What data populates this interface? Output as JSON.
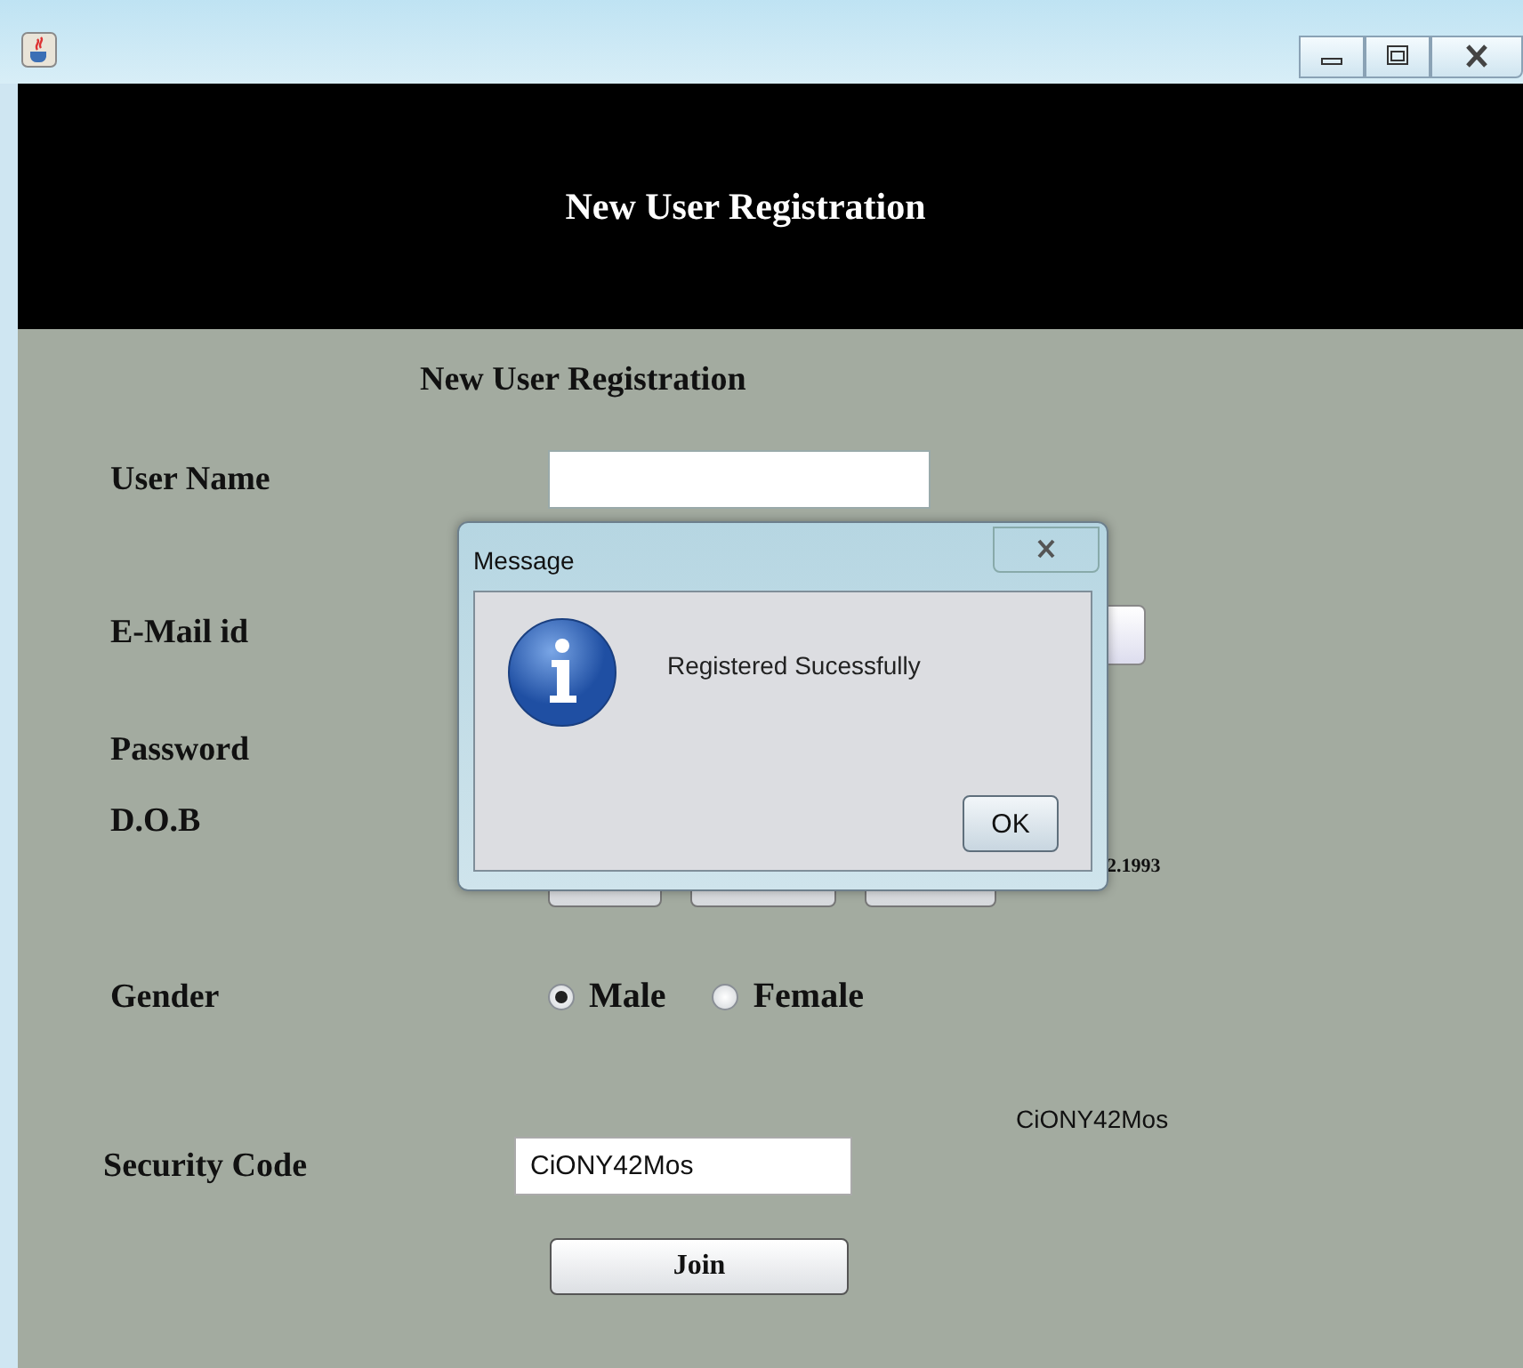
{
  "header": {
    "title": "New User Registration"
  },
  "form": {
    "subtitle": "New User Registration",
    "user_name": {
      "label": "User Name"
    },
    "email": {
      "label": "E-Mail id"
    },
    "password": {
      "label": "Password"
    },
    "dob": {
      "label": "D.O.B",
      "date_text": "2.1993"
    },
    "gender": {
      "label": "Gender",
      "options": [
        {
          "label": "Male",
          "selected": true
        },
        {
          "label": "Female",
          "selected": false
        }
      ]
    },
    "security_code": {
      "label": "Security Code",
      "value": "CiONY42Mos",
      "code_text": "CiONY42Mos"
    },
    "join_button": "Join"
  },
  "dialog": {
    "title": "Message",
    "message": "Registered Sucessfully",
    "ok_button": "OK"
  }
}
